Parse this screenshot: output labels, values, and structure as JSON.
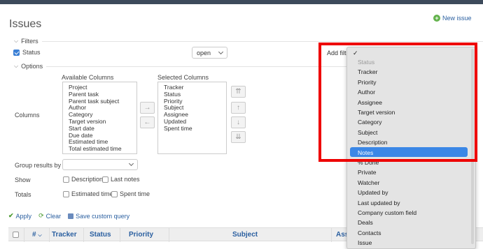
{
  "header": {
    "title": "Issues",
    "new_issue_label": "New issue"
  },
  "filters": {
    "legend": "Filters",
    "status_label": "Status",
    "status_checked": true,
    "status_operator": "open",
    "add_filter_label": "Add filter"
  },
  "options": {
    "legend": "Options",
    "columns_label": "Columns",
    "available_columns_label": "Available Columns",
    "selected_columns_label": "Selected Columns",
    "available_columns": [
      "Project",
      "Parent task",
      "Parent task subject",
      "Author",
      "Category",
      "Target version",
      "Start date",
      "Due date",
      "Estimated time",
      "Total estimated time"
    ],
    "selected_columns": [
      "Tracker",
      "Status",
      "Priority",
      "Subject",
      "Assignee",
      "Updated",
      "Spent time"
    ],
    "move_right_symbol": "→",
    "move_left_symbol": "←",
    "order_buttons": [
      "⇈",
      "↑",
      "↓",
      "⇊"
    ],
    "group_results_by_label": "Group results by",
    "group_results_by_value": "",
    "show_label": "Show",
    "show_options": [
      "Description",
      "Last notes"
    ],
    "totals_label": "Totals",
    "totals_options": [
      "Estimated time",
      "Spent time"
    ]
  },
  "actions": {
    "apply": "Apply",
    "clear": "Clear",
    "save_custom_query": "Save custom query"
  },
  "table": {
    "columns": [
      "#",
      "Tracker",
      "Status",
      "Priority",
      "Subject",
      "Ass"
    ]
  },
  "add_filter_dropdown": {
    "checkmark": "✓",
    "items": [
      {
        "label": "Status",
        "disabled": true
      },
      {
        "label": "Tracker"
      },
      {
        "label": "Priority"
      },
      {
        "label": "Author"
      },
      {
        "label": "Assignee"
      },
      {
        "label": "Target version"
      },
      {
        "label": "Category"
      },
      {
        "label": "Subject"
      },
      {
        "label": "Description"
      },
      {
        "label": "Notes",
        "highlighted": true
      },
      {
        "label": "% Done"
      },
      {
        "label": "Private"
      },
      {
        "label": "Watcher"
      },
      {
        "label": "Updated by"
      },
      {
        "label": "Last updated by"
      },
      {
        "label": "Company custom field"
      },
      {
        "label": "Deals"
      },
      {
        "label": "Contacts"
      },
      {
        "label": "Issue"
      }
    ]
  },
  "colors": {
    "highlight": "#3b87e6",
    "annotation_box": "#ee0000",
    "link": "#2a5fa0"
  }
}
